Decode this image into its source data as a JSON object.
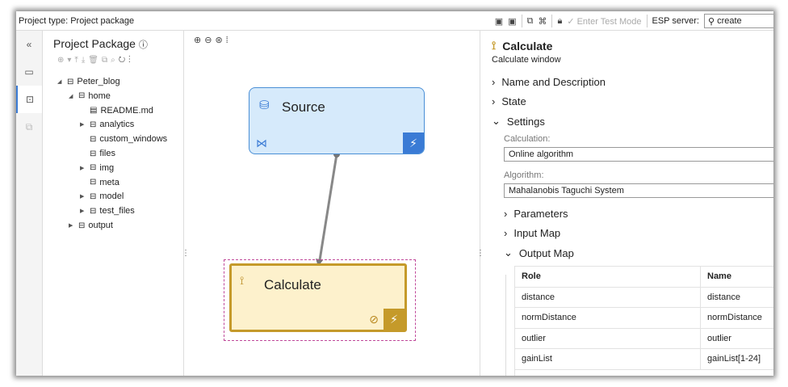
{
  "topbar": {
    "project_type_label": "Project type:",
    "project_type_value": "Project package",
    "test_mode": "Enter Test Mode",
    "esp_label": "ESP server:",
    "esp_value": "create"
  },
  "tree": {
    "title": "Project Package",
    "items": [
      {
        "label": "Peter_blog",
        "level": 0,
        "toggle": "open"
      },
      {
        "label": "home",
        "level": 1,
        "toggle": "open"
      },
      {
        "label": "README.md",
        "level": 2,
        "toggle": "none",
        "file": true
      },
      {
        "label": "analytics",
        "level": 2,
        "toggle": "closed"
      },
      {
        "label": "custom_windows",
        "level": 2,
        "toggle": "none"
      },
      {
        "label": "files",
        "level": 2,
        "toggle": "none"
      },
      {
        "label": "img",
        "level": 2,
        "toggle": "closed"
      },
      {
        "label": "meta",
        "level": 2,
        "toggle": "none"
      },
      {
        "label": "model",
        "level": 2,
        "toggle": "closed"
      },
      {
        "label": "test_files",
        "level": 2,
        "toggle": "closed"
      },
      {
        "label": "output",
        "level": 1,
        "toggle": "closed"
      }
    ]
  },
  "canvas": {
    "source_label": "Source",
    "calculate_label": "Calculate"
  },
  "panel": {
    "title": "Calculate",
    "subtitle": "Calculate window",
    "sections": {
      "name_desc": "Name and Description",
      "state": "State",
      "settings": "Settings",
      "parameters": "Parameters",
      "input_map": "Input Map",
      "output_map": "Output Map"
    },
    "calculation_label": "Calculation:",
    "calculation_value": "Online algorithm",
    "algorithm_label": "Algorithm:",
    "algorithm_value": "Mahalanobis Taguchi System",
    "output_table": {
      "headers": [
        "Role",
        "Name"
      ],
      "rows": [
        [
          "distance",
          "distance"
        ],
        [
          "normDistance",
          "normDistance"
        ],
        [
          "outlier",
          "outlier"
        ],
        [
          "gainList",
          "gainList[1-24]"
        ]
      ]
    }
  },
  "colors": {
    "source_fill": "#d6eafb",
    "source_border": "#4a8fd6",
    "calc_fill": "#fdf1cc",
    "calc_border": "#c59a2a"
  }
}
